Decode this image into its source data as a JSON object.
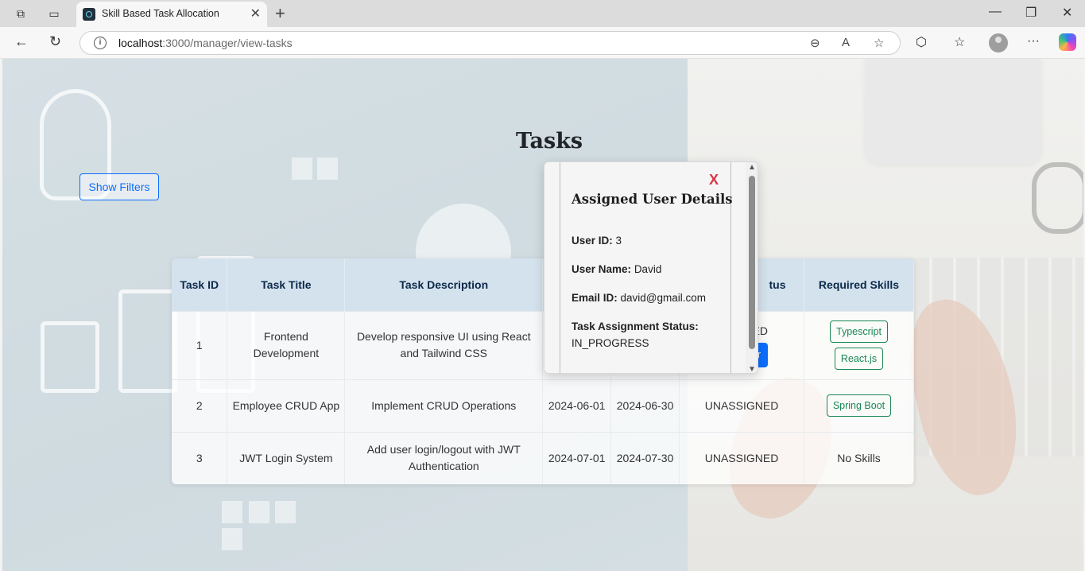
{
  "browser": {
    "tab_title": "Skill Based Task Allocation",
    "url_host": "localhost",
    "url_path": ":3000/manager/view-tasks"
  },
  "page": {
    "title": "Tasks",
    "filters_button": "Show Filters"
  },
  "table": {
    "headers": [
      "Task ID",
      "Task Title",
      "Task Description",
      "",
      "",
      "tus",
      "Required Skills"
    ],
    "rows": [
      {
        "id": "1",
        "title": "Frontend Development",
        "description": "Develop responsive UI using React and Tailwind CSS",
        "start": "",
        "end": "",
        "status": "ED",
        "assign_button": "User",
        "skills": [
          "Typescript",
          "React.js"
        ]
      },
      {
        "id": "2",
        "title": "Employee CRUD App",
        "description": "Implement CRUD Operations",
        "start": "2024-06-01",
        "end": "2024-06-30",
        "status": "UNASSIGNED",
        "skills": [
          "Spring Boot"
        ]
      },
      {
        "id": "3",
        "title": "JWT Login System",
        "description": "Add user login/logout with JWT Authentication",
        "start": "2024-07-01",
        "end": "2024-07-30",
        "status": "UNASSIGNED",
        "no_skills": "No Skills"
      }
    ]
  },
  "modal": {
    "close": "X",
    "title": "Assigned User Details",
    "user_id_label": "User ID:",
    "user_id": "3",
    "user_name_label": "User Name:",
    "user_name": "David",
    "email_label": "Email ID:",
    "email": "david@gmail.com",
    "status_label": "Task Assignment Status:",
    "status": "IN_PROGRESS"
  },
  "colors": {
    "primary": "#0d6efd",
    "skill": "#198754",
    "close": "#dc3545",
    "header_bg": "#d4e2ee"
  }
}
